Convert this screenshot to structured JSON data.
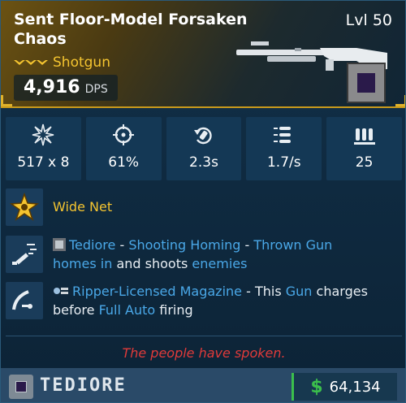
{
  "item": {
    "name": "Sent Floor-Model Forsaken Chaos",
    "level": "Lvl 50",
    "rarity_icon": "legendary-chevrons-icon",
    "type": "Shotgun",
    "dps_value": "4,916",
    "dps_unit": "DPS"
  },
  "stats": [
    {
      "icon": "damage-burst-icon",
      "value": "517 x 8"
    },
    {
      "icon": "crosshair-accuracy-icon",
      "value": "61%"
    },
    {
      "icon": "reload-time-icon",
      "value": "2.3s"
    },
    {
      "icon": "fire-rate-icon",
      "value": "1.7/s"
    },
    {
      "icon": "magazine-ammo-icon",
      "value": "25"
    }
  ],
  "perks": {
    "wide_net": {
      "icon": "star-burst-icon",
      "label": "Wide Net"
    },
    "tediore": {
      "icon": "thrown-gun-icon",
      "brand": "Tediore",
      "sep1": " - ",
      "part1": "Shooting Homing",
      "sep2": " - ",
      "part2": "Thrown Gun",
      "line2_a": "homes in",
      "line2_b": " and shoots ",
      "line2_c": "enemies"
    },
    "ripper": {
      "icon": "charge-magazine-icon",
      "name": "Ripper-Licensed Magazine",
      "sep": " - This ",
      "gun": "Gun",
      "charges": " charges",
      "before": "before ",
      "full_auto": "Full Auto",
      "firing": " firing"
    }
  },
  "flavor_text": "The people have spoken.",
  "manufacturer": {
    "name": "TEDIORE",
    "icon": "tediore-badge-icon"
  },
  "price": {
    "icon": "$",
    "value": "64,134"
  },
  "colors": {
    "legendary": "#f4c430",
    "highlight": "#4aa8e8",
    "flavor": "#e03a3a",
    "money": "#3bbf4c"
  }
}
